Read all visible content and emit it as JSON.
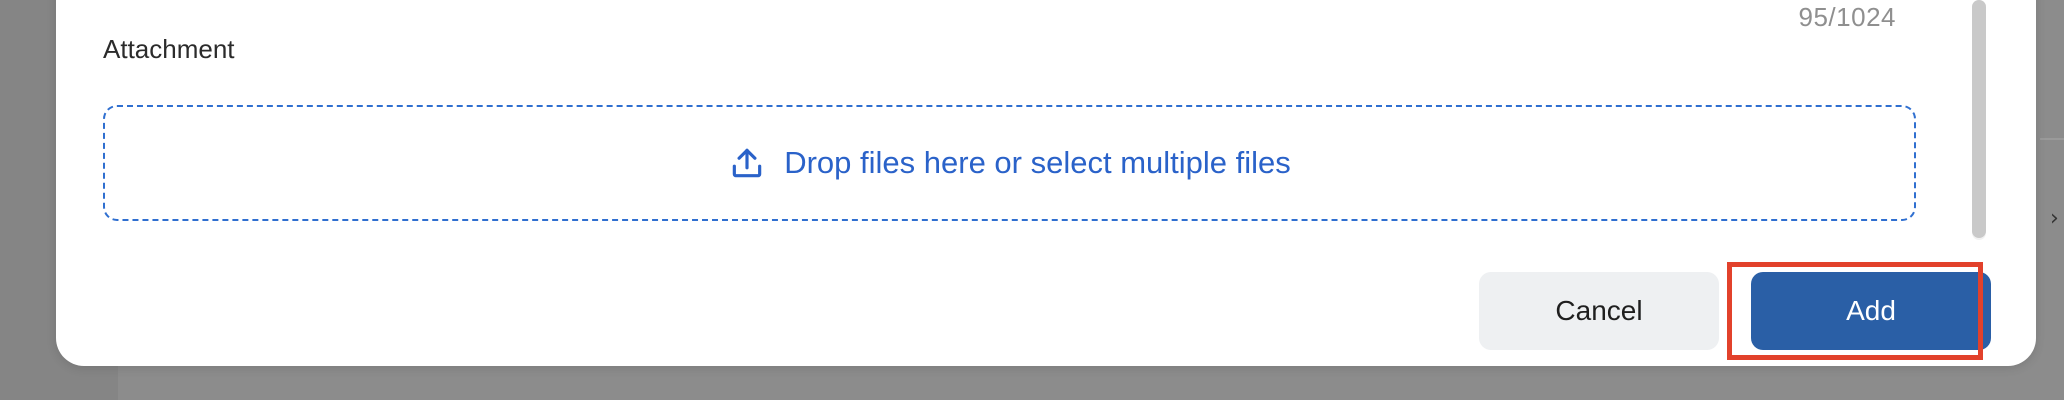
{
  "dialog": {
    "char_counter": "95/1024",
    "attachment_label": "Attachment",
    "dropzone": {
      "icon": "upload-icon",
      "text": "Drop files here or select multiple files"
    },
    "buttons": {
      "cancel": "Cancel",
      "add": "Add"
    }
  },
  "colors": {
    "accent": "#2a62c9",
    "primary_button": "#2a5fa6",
    "secondary_button": "#eef0f2",
    "highlight": "#e2412b"
  }
}
